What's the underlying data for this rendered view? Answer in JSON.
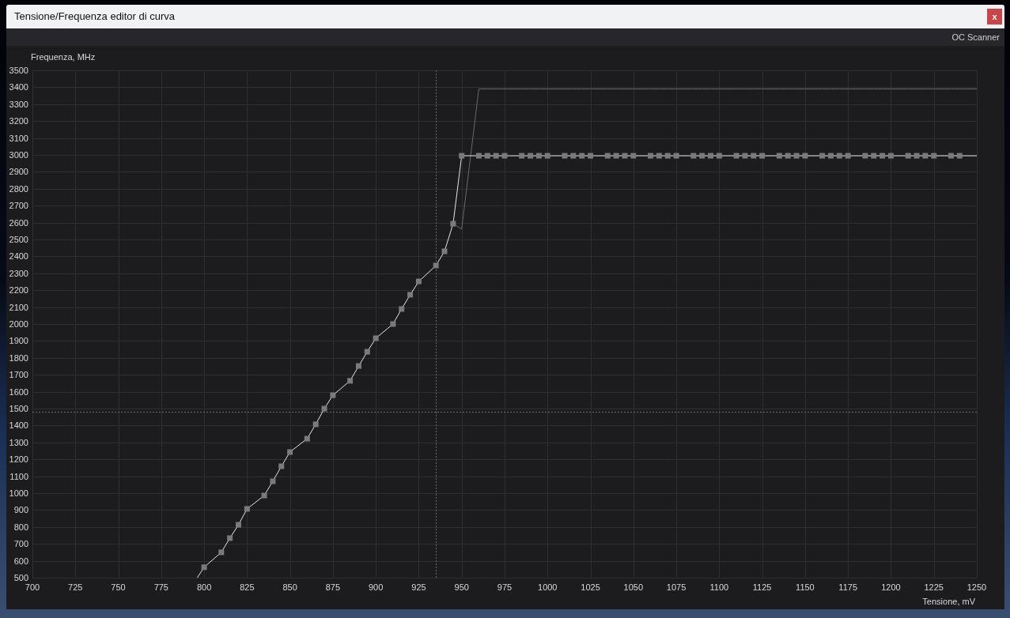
{
  "window": {
    "title": "Tensione/Frequenza editor di curva",
    "close_label": "x"
  },
  "toolbar": {
    "button": "OC Scanner"
  },
  "chart": {
    "chart_data": {
      "type": "line",
      "xlabel": "Tensione, mV",
      "ylabel": "Frequenza, MHz",
      "xlim": [
        700,
        1250
      ],
      "ylim": [
        500,
        3500
      ],
      "xticks": [
        700,
        725,
        750,
        775,
        800,
        825,
        850,
        875,
        900,
        925,
        950,
        975,
        1000,
        1025,
        1050,
        1075,
        1100,
        1125,
        1150,
        1175,
        1200,
        1225,
        1250
      ],
      "yticks": [
        500,
        600,
        700,
        800,
        900,
        1000,
        1100,
        1200,
        1300,
        1400,
        1500,
        1600,
        1700,
        1800,
        1900,
        2000,
        2100,
        2200,
        2300,
        2400,
        2500,
        2600,
        2700,
        2800,
        2900,
        3000,
        3100,
        3200,
        3300,
        3400,
        3500
      ],
      "grid": true,
      "x": [
        796,
        800,
        810,
        815,
        820,
        825,
        835,
        840,
        845,
        850,
        860,
        865,
        870,
        875,
        885,
        890,
        895,
        900,
        910,
        915,
        920,
        925,
        935,
        940,
        945,
        950,
        960,
        965,
        970,
        975,
        985,
        990,
        995,
        1000,
        1010,
        1015,
        1020,
        1025,
        1035,
        1040,
        1045,
        1050,
        1060,
        1065,
        1070,
        1075,
        1085,
        1090,
        1095,
        1100,
        1110,
        1115,
        1120,
        1125,
        1135,
        1140,
        1145,
        1150,
        1160,
        1165,
        1170,
        1175,
        1185,
        1190,
        1195,
        1200,
        1210,
        1215,
        1220,
        1225,
        1235,
        1240,
        1250
      ],
      "series": [
        {
          "color": "#e6e6e6",
          "marker": "square",
          "values": [
            500,
            562,
            650,
            734,
            813,
            907,
            986,
            1070,
            1159,
            1243,
            1322,
            1407,
            1500,
            1579,
            1664,
            1752,
            1836,
            1916,
            2000,
            2089,
            2173,
            2252,
            2346,
            2430,
            2593,
            2995,
            2995,
            2995,
            2995,
            2995,
            2995,
            2995,
            2995,
            2995,
            2995,
            2995,
            2995,
            2995,
            2995,
            2995,
            2995,
            2995,
            2995,
            2995,
            2995,
            2995,
            2995,
            2995,
            2995,
            2995,
            2995,
            2995,
            2995,
            2995,
            2995,
            2995,
            2995,
            2995,
            2995,
            2995,
            2995,
            2995,
            2995,
            2995,
            2995,
            2995,
            2995,
            2995,
            2995,
            2995,
            2995,
            2995,
            2995
          ]
        },
        {
          "color": "#6a6a6e",
          "marker": "none",
          "values": [
            null,
            null,
            null,
            null,
            null,
            null,
            null,
            null,
            null,
            null,
            null,
            null,
            null,
            null,
            null,
            null,
            null,
            null,
            null,
            null,
            null,
            null,
            null,
            null,
            2593,
            2561,
            3390,
            3390,
            3390,
            3390,
            3390,
            3390,
            3390,
            3390,
            3390,
            3390,
            3390,
            3390,
            3390,
            3390,
            3390,
            3390,
            3390,
            3390,
            3390,
            3390,
            3390,
            3390,
            3390,
            3390,
            3390,
            3390,
            3390,
            3390,
            3390,
            3390,
            3390,
            3390,
            3390,
            3390,
            3390,
            3390,
            3390,
            3390,
            3390,
            3390,
            3390,
            3390,
            3390,
            3390,
            3390,
            3390,
            3390
          ]
        }
      ],
      "ref_lines": [
        {
          "axis": "x",
          "value": 935
        },
        {
          "axis": "y",
          "value": 1480
        }
      ]
    }
  }
}
